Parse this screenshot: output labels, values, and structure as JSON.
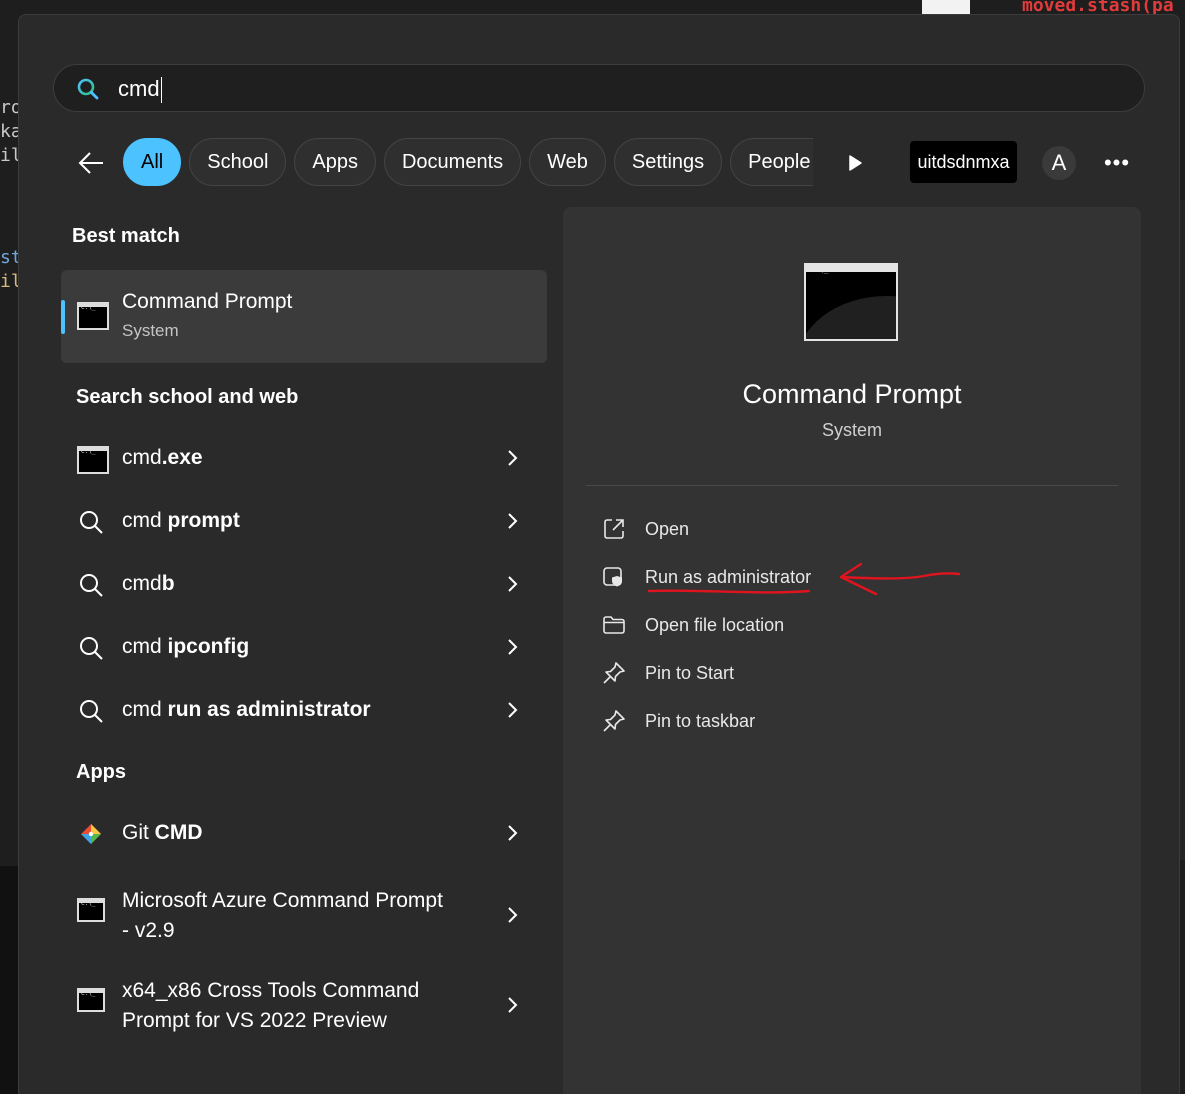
{
  "search": {
    "query": "cmd"
  },
  "filters": [
    {
      "label": "All",
      "active": true
    },
    {
      "label": "School",
      "active": false
    },
    {
      "label": "Apps",
      "active": false
    },
    {
      "label": "Documents",
      "active": false
    },
    {
      "label": "Web",
      "active": false
    },
    {
      "label": "Settings",
      "active": false
    },
    {
      "label": "People",
      "active": false
    }
  ],
  "account": {
    "name": "uitdsdnmxa",
    "avatar_initial": "A"
  },
  "best_match": {
    "heading": "Best match",
    "title": "Command Prompt",
    "subtitle": "System"
  },
  "search_web": {
    "heading": "Search school and web",
    "items": [
      {
        "prefix": "cmd",
        "bold": ".exe",
        "icon": "cmd-app-icon"
      },
      {
        "prefix": "cmd ",
        "bold": "prompt",
        "icon": "search-icon"
      },
      {
        "prefix": "cmd",
        "bold": "b",
        "icon": "search-icon"
      },
      {
        "prefix": "cmd ",
        "bold": "ipconfig",
        "icon": "search-icon"
      },
      {
        "prefix": "cmd ",
        "bold": "run as administrator",
        "icon": "search-icon"
      }
    ]
  },
  "apps": {
    "heading": "Apps",
    "items": [
      {
        "prefix": "Git ",
        "bold": "CMD",
        "icon": "git-icon"
      },
      {
        "line1": "Microsoft Azure Command Prompt",
        "line2": "- v2.9",
        "icon": "cmd-app-icon"
      },
      {
        "line1": "x64_x86 Cross Tools Command",
        "line2": "Prompt for VS 2022 Preview",
        "icon": "cmd-app-icon"
      }
    ]
  },
  "detail": {
    "title": "Command Prompt",
    "category": "System",
    "actions": [
      {
        "label": "Open",
        "icon": "open-external-icon"
      },
      {
        "label": "Run as administrator",
        "icon": "shield-window-icon"
      },
      {
        "label": "Open file location",
        "icon": "folder-icon"
      },
      {
        "label": "Pin to Start",
        "icon": "pin-icon"
      },
      {
        "label": "Pin to taskbar",
        "icon": "pin-icon"
      }
    ]
  },
  "background": {
    "top_right_code": "moved.stash(pa",
    "left_code_lines": [
      "ro",
      "ka",
      "il"
    ],
    "left_code_lines2": [
      "st",
      "il"
    ]
  },
  "colors": {
    "accent": "#4cc2ff",
    "annotation": "#e0141e",
    "panel": "#2a2a2a",
    "detail_panel": "#333333"
  }
}
